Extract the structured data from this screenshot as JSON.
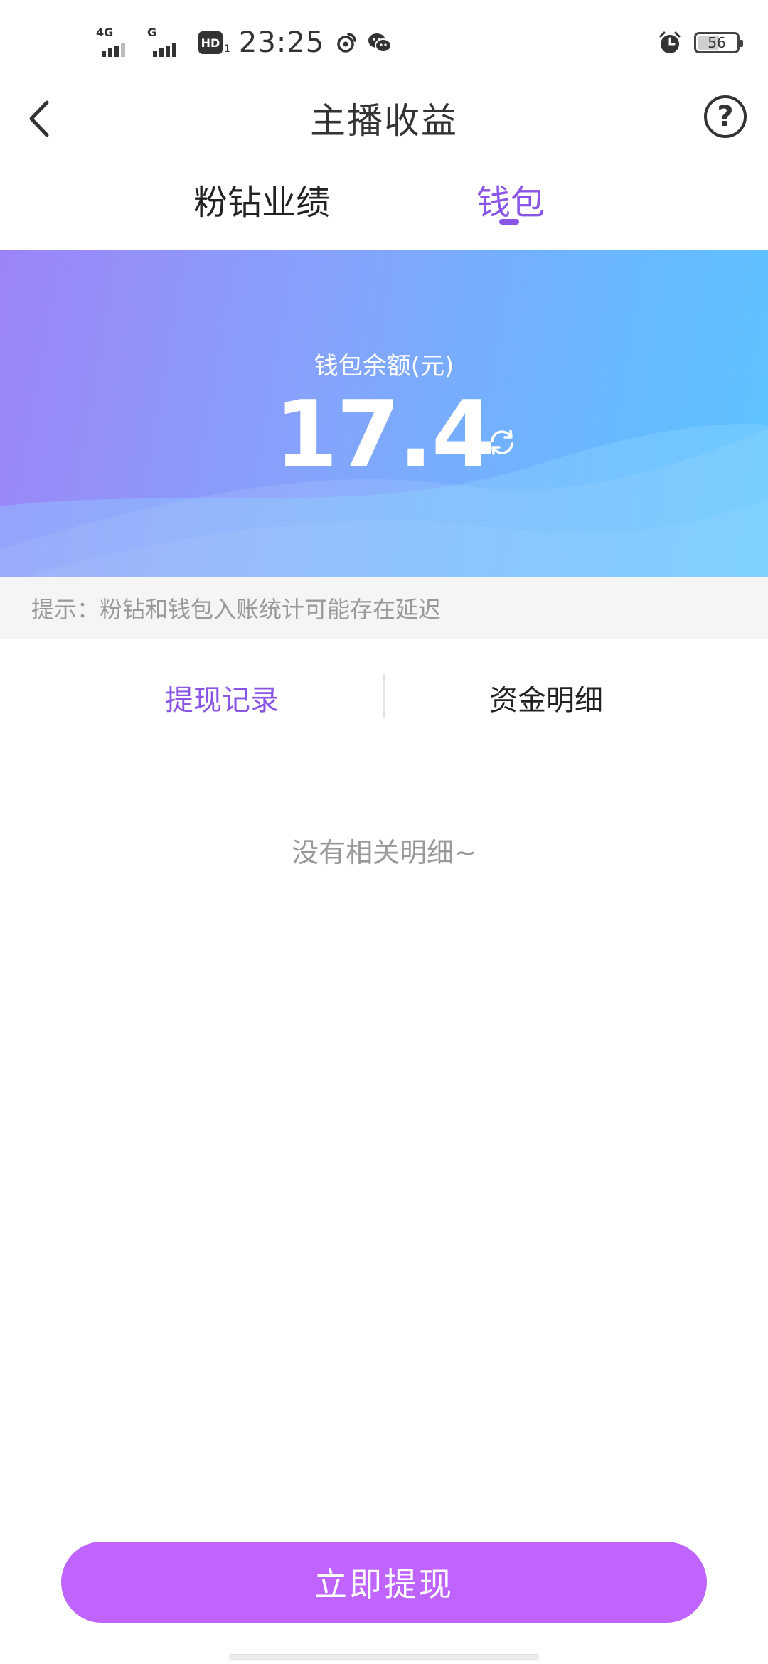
{
  "status_bar": {
    "network_1": "4G",
    "network_2": "G",
    "hd": "HD",
    "hd_sub": "1",
    "time": "23:25",
    "battery": "56",
    "icons": [
      "weibo-icon",
      "wechat-icon",
      "alarm-icon"
    ]
  },
  "header": {
    "title": "主播收益",
    "help_symbol": "?"
  },
  "tabs": [
    {
      "label": "粉钻业绩",
      "active": false
    },
    {
      "label": "钱包",
      "active": true
    }
  ],
  "wallet": {
    "label": "钱包余额(元)",
    "balance": "17.4"
  },
  "tip": "提示：粉钻和钱包入账统计可能存在延迟",
  "sub_tabs": [
    {
      "label": "提现记录",
      "active": true
    },
    {
      "label": "资金明细",
      "active": false
    }
  ],
  "empty_state": "没有相关明细~",
  "withdraw_button": "立即提现",
  "colors": {
    "accent": "#8a55e6",
    "button": "#c064ff",
    "banner_start": "#9c84f8",
    "banner_end": "#5cc4ff"
  }
}
